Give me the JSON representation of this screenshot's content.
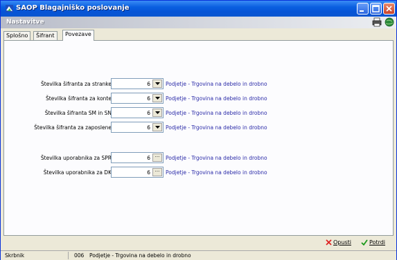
{
  "window": {
    "title": "SAOP Blagajniško poslovanje"
  },
  "header": {
    "title": "Nastavitve"
  },
  "tabs": [
    {
      "label": "Splošno",
      "active": false
    },
    {
      "label": "Šifrant",
      "active": false
    },
    {
      "label": "Povezave",
      "active": true
    }
  ],
  "rows": [
    {
      "label": "Številka šifranta za stranke",
      "value": "6",
      "control": "dropdown",
      "description": "Podjetje - Trgovina na debelo in drobno"
    },
    {
      "label": "Številka šifranta za konte",
      "value": "6",
      "control": "dropdown",
      "description": "Podjetje - Trgovina na debelo in drobno"
    },
    {
      "label": "Številka šifranta SM in SN",
      "value": "6",
      "control": "dropdown",
      "description": "Podjetje - Trgovina na debelo in drobno"
    },
    {
      "label": "Številka šifranta za zaposlene",
      "value": "6",
      "control": "dropdown",
      "description": "Podjetje - Trgovina na debelo in drobno"
    },
    {
      "label": "Številka uporabnika za SPR",
      "value": "6",
      "control": "browse",
      "description": "Podjetje - Trgovina na debelo in drobno"
    },
    {
      "label": "Številka uporabnika za DK",
      "value": "6",
      "control": "browse",
      "description": "Podjetje - Trgovina na debelo in drobno"
    }
  ],
  "buttons": {
    "cancel": "Opusti",
    "confirm": "Potrdi"
  },
  "statusbar": {
    "user": "Skrbnik",
    "company_code": "006",
    "company_name": "Podjetje - Trgovina na debelo in drobno"
  },
  "colors": {
    "title_bar": "#0654d6",
    "description_text": "#2a2aa8",
    "window_bg": "#ece9d8"
  },
  "icons": [
    "app-icon",
    "printer-icon",
    "globe-icon",
    "minimize-icon",
    "maximize-icon",
    "close-icon",
    "dropdown-arrow-icon",
    "cancel-x-icon",
    "checkmark-icon"
  ]
}
